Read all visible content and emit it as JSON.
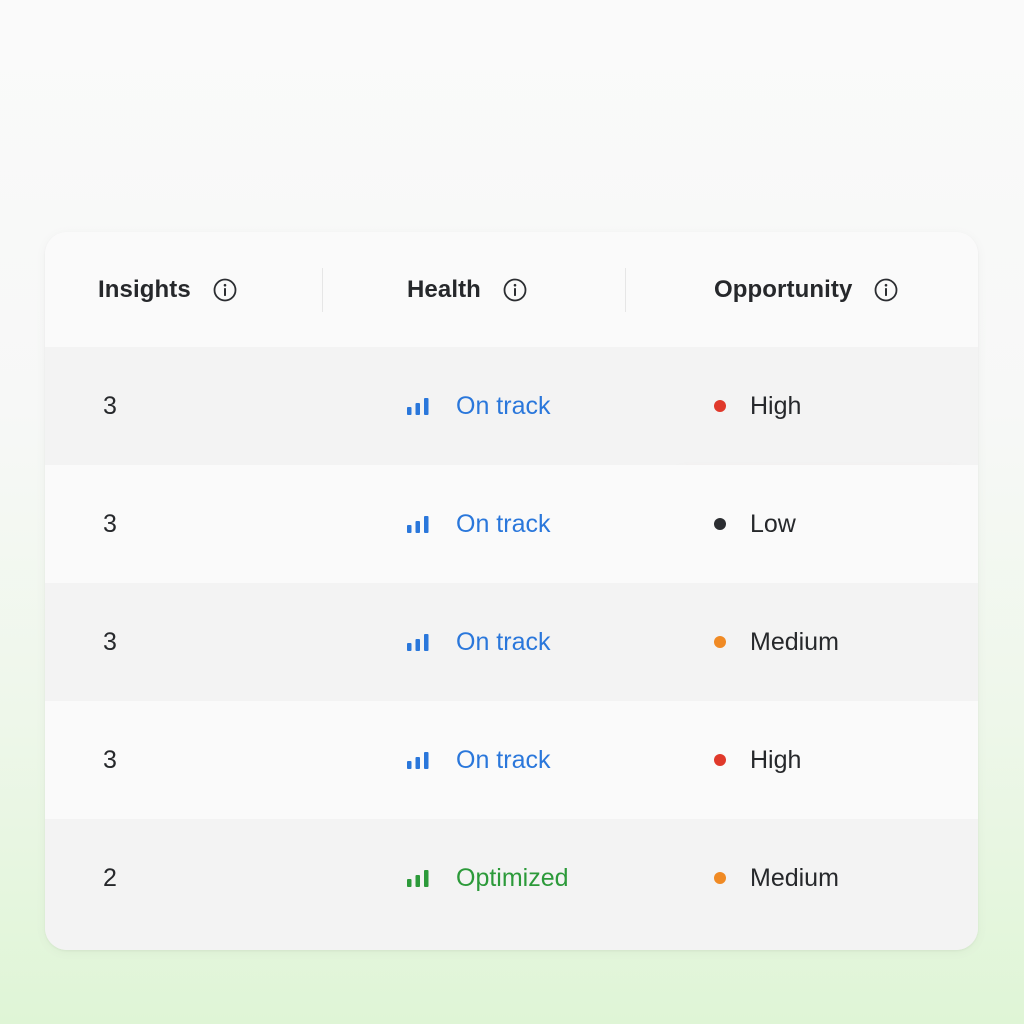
{
  "table": {
    "columns": [
      {
        "label": "Insights",
        "icon": "info-icon"
      },
      {
        "label": "Health",
        "icon": "info-icon"
      },
      {
        "label": "Opportunity",
        "icon": "info-icon"
      }
    ],
    "rows": [
      {
        "insights": "3",
        "health": "On track",
        "health_status": "on-track",
        "opportunity": "High",
        "opportunity_level": "high"
      },
      {
        "insights": "3",
        "health": "On track",
        "health_status": "on-track",
        "opportunity": "Low",
        "opportunity_level": "low"
      },
      {
        "insights": "3",
        "health": "On track",
        "health_status": "on-track",
        "opportunity": "Medium",
        "opportunity_level": "medium"
      },
      {
        "insights": "3",
        "health": "On track",
        "health_status": "on-track",
        "opportunity": "High",
        "opportunity_level": "high"
      },
      {
        "insights": "2",
        "health": "Optimized",
        "health_status": "optimized",
        "opportunity": "Medium",
        "opportunity_level": "medium"
      }
    ],
    "selected_cell": {
      "row": 0,
      "column": "opportunity"
    }
  },
  "colors": {
    "on_track": "#2a77db",
    "optimized": "#2c9a3a",
    "high": "#e0392b",
    "medium": "#f08a24",
    "low": "#2b2d31",
    "header_text": "#26282b",
    "highlight_border": "#f0cfc9"
  }
}
